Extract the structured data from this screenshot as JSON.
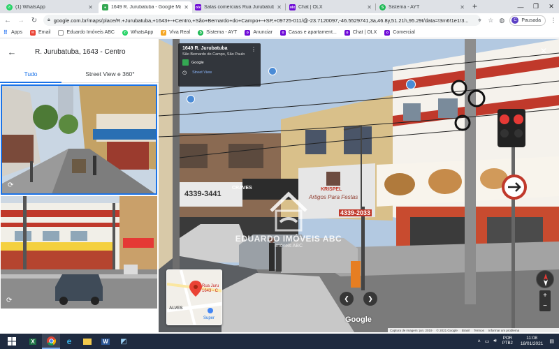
{
  "tabs": [
    {
      "title": "(1) WhatsApp",
      "icon": "whatsapp-icon",
      "color": "#25d366",
      "active": false
    },
    {
      "title": "1649 R. Jurubatuba - Google Ma...",
      "icon": "google-maps-icon",
      "color": "#34a853",
      "active": true
    },
    {
      "title": "Salas comerciais Rua Jurubatuba",
      "icon": "olx-icon",
      "color": "#6e0ad6",
      "active": false
    },
    {
      "title": "Chat | OLX",
      "icon": "olx-icon",
      "color": "#6e0ad6",
      "active": false
    },
    {
      "title": "Sistema - AYT",
      "icon": "sistema-icon",
      "color": "#1db954",
      "active": false
    }
  ],
  "window": {
    "minimize": "—",
    "maximize": "❐",
    "close": "✕",
    "new_tab": "+"
  },
  "address_bar": {
    "url": "google.com.br/maps/place/R.+Jurubatuba,+1643+-+Centro,+São+Bernardo+do+Campo+-+SP,+09725-011/@-23.7120097,-46.5529741,3a,46.8y,51.21h,95.29t/data=!3m6!1e1!3...",
    "profile_name": "Pausada",
    "profile_initial": "C"
  },
  "bookmarks": [
    {
      "label": "Apps",
      "icon": "apps-grid-icon",
      "color": "#5f6368"
    },
    {
      "label": "Email",
      "icon": "email-icon",
      "color": "#ea4335"
    },
    {
      "label": "Eduardo Imóveis ABC",
      "icon": "page-icon",
      "color": "#4285f4"
    },
    {
      "label": "WhatsApp",
      "icon": "whatsapp-icon",
      "color": "#25d366"
    },
    {
      "label": "Viva Real",
      "icon": "vivareal-icon",
      "color": "#f5a623"
    },
    {
      "label": "Sistema - AYT",
      "icon": "sistema-icon",
      "color": "#1db954"
    },
    {
      "label": "Anunciar",
      "icon": "olx-icon",
      "color": "#6e0ad6"
    },
    {
      "label": "Casas e apartament...",
      "icon": "olx-icon",
      "color": "#6e0ad6"
    },
    {
      "label": "Chat | OLX",
      "icon": "olx-icon",
      "color": "#6e0ad6"
    },
    {
      "label": "Comercial",
      "icon": "olx-icon",
      "color": "#6e0ad6"
    }
  ],
  "panel": {
    "title": "R. Jurubatuba, 1643 - Centro",
    "tab_all": "Tudo",
    "tab_street": "Street View e 360°"
  },
  "infocard": {
    "title": "1649 R. Jurubatuba",
    "subtitle": "São Bernardo do Campo, São Paulo",
    "provider": "Google",
    "mode": "Street View"
  },
  "storefront": {
    "phone": "4339-3441",
    "shop_name": "KRISPEL",
    "shop_tag": "Artigos Para Festas",
    "shop_phone": "4339-2033",
    "sign_center": "CRAVES"
  },
  "watermark": {
    "name": "EDUARDO IMÓVEIS ABC",
    "sub": "Imóveis ABC"
  },
  "minimap": {
    "street": "Rua Juru 1643 - C",
    "label_a": "ALVES",
    "label_b": "Super"
  },
  "google_logo": "Google",
  "footer": [
    "Captura de imagem: jun. 2019",
    "© 2021 Google",
    "Brasil",
    "Termos",
    "Informar um problema"
  ],
  "taskbar": {
    "lang_top": "POR",
    "lang_bottom": "PTB2",
    "time": "11:08",
    "date": "18/01/2021"
  }
}
